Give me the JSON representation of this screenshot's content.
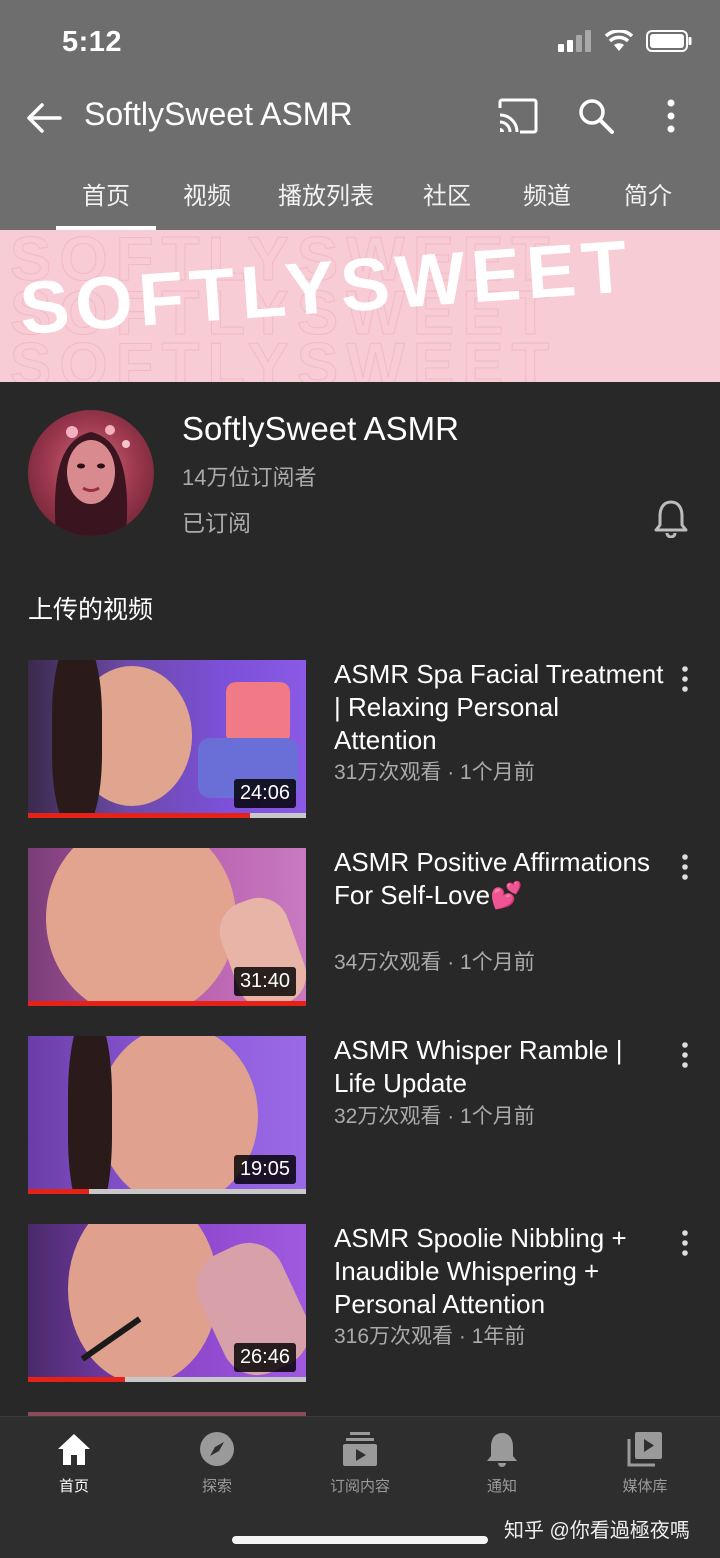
{
  "status_bar": {
    "time": "5:12"
  },
  "app_bar": {
    "title": "SoftlySweet ASMR",
    "tabs": [
      "首页",
      "视频",
      "播放列表",
      "社区",
      "频道",
      "简介"
    ],
    "active_tab": 0
  },
  "banner": {
    "text": "SOFTLYSWEET"
  },
  "channel": {
    "name": "SoftlySweet ASMR",
    "subscribers": "14万位订阅者",
    "subscribed_label": "已订阅"
  },
  "section_title": "上传的视频",
  "videos": [
    {
      "title": "ASMR Spa Facial Treatment | Relaxing Personal Attention",
      "meta": "31万次观看 · 1个月前",
      "duration": "24:06",
      "progress": 0.8
    },
    {
      "title": "ASMR Positive Affirmations For Self-Love💕",
      "meta": "34万次观看 · 1个月前",
      "duration": "31:40",
      "progress": 1.0
    },
    {
      "title": "ASMR Whisper Ramble | Life Update",
      "meta": "32万次观看 · 1个月前",
      "duration": "19:05",
      "progress": 0.22
    },
    {
      "title": "ASMR Spoolie Nibbling + Inaudible Whispering + Personal Attention",
      "meta": "316万次观看 · 1年前",
      "duration": "26:46",
      "progress": 0.35
    }
  ],
  "bottom_nav": [
    {
      "label": "首页",
      "icon": "home-icon"
    },
    {
      "label": "探索",
      "icon": "explore-icon"
    },
    {
      "label": "订阅内容",
      "icon": "subscriptions-icon"
    },
    {
      "label": "通知",
      "icon": "bell-icon"
    },
    {
      "label": "媒体库",
      "icon": "library-icon"
    }
  ],
  "watermark": "知乎 @你看過極夜嗎",
  "colors": {
    "accent": "#e62117",
    "background": "#282828",
    "header": "#6e6e6e",
    "banner": "#f7ccd4"
  }
}
